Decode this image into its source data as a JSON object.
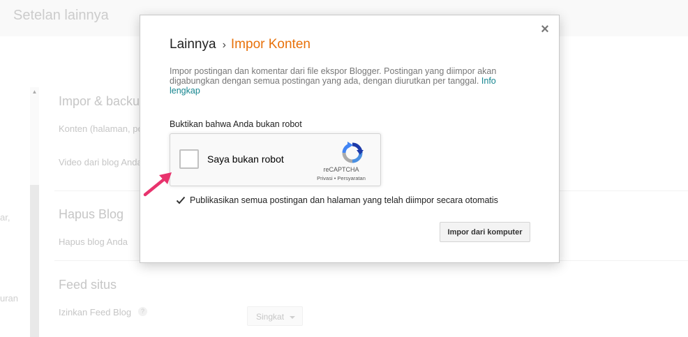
{
  "background": {
    "page_title": "Setelan lainnya",
    "section_import_title": "Impor & backu",
    "content_row": "Konten (halaman, po",
    "video_row": "Video dari blog Anda",
    "left_fragment_1": "ar,",
    "left_fragment_2": "uran",
    "section_delete_title": "Hapus Blog",
    "delete_row": "Hapus blog Anda",
    "section_feed_title": "Feed situs",
    "feed_row": "Izinkan Feed Blog",
    "help_glyph": "?",
    "feed_select_value": "Singkat"
  },
  "dialog": {
    "breadcrumb_root": "Lainnya",
    "breadcrumb_separator": "›",
    "breadcrumb_current": "Impor Konten",
    "close_glyph": "×",
    "description": "Impor postingan dan komentar dari file ekspor Blogger. Postingan yang diimpor akan digabungkan dengan semua postingan yang ada, dengan diurutkan per tanggal.",
    "info_link": "Info lengkap",
    "robot_label": "Buktikan bahwa Anda bukan robot",
    "recaptcha": {
      "label": "Saya bukan robot",
      "brand": "reCAPTCHA",
      "links": "Privasi • Persyaratan",
      "checked": false
    },
    "auto_publish": {
      "label": "Publikasikan semua postingan dan halaman yang telah diimpor secara otomatis",
      "checked": true
    },
    "import_button": "Impor dari komputer"
  },
  "colors": {
    "accent_orange": "#e8710a",
    "link_teal": "#15858f",
    "annotation_pink": "#e8336d"
  },
  "icons": {
    "close": "close-icon",
    "recaptcha": "recaptcha-logo-icon",
    "check": "checkmark-icon",
    "arrow": "annotation-arrow-icon",
    "scroll_up": "chevron-up-icon",
    "dropdown": "chevron-down-icon"
  }
}
